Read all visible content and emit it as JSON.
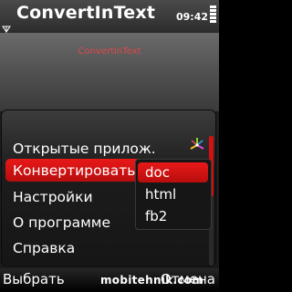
{
  "app": {
    "title": "ConvertInText",
    "clock": "09:42"
  },
  "content": {
    "label": "ConvertInText"
  },
  "menu": {
    "items": [
      {
        "label": "Открытые прилож."
      },
      {
        "label": "Конвертировать"
      },
      {
        "label": "Настройки"
      },
      {
        "label": "О программе"
      },
      {
        "label": "Справка"
      }
    ],
    "selected_index": 1
  },
  "submenu": {
    "items": [
      {
        "label": "doc"
      },
      {
        "label": "html"
      },
      {
        "label": "fb2"
      }
    ],
    "selected_index": 0
  },
  "softkeys": {
    "left": "Выбрать",
    "right": "Отмена"
  },
  "watermark": "mobitehnik.com",
  "colors": {
    "accent": "#d31111",
    "highlight": "#e81818",
    "content_text": "#e04848"
  },
  "icons": [
    "battery-icon",
    "signal-icon",
    "gear-icon"
  ]
}
